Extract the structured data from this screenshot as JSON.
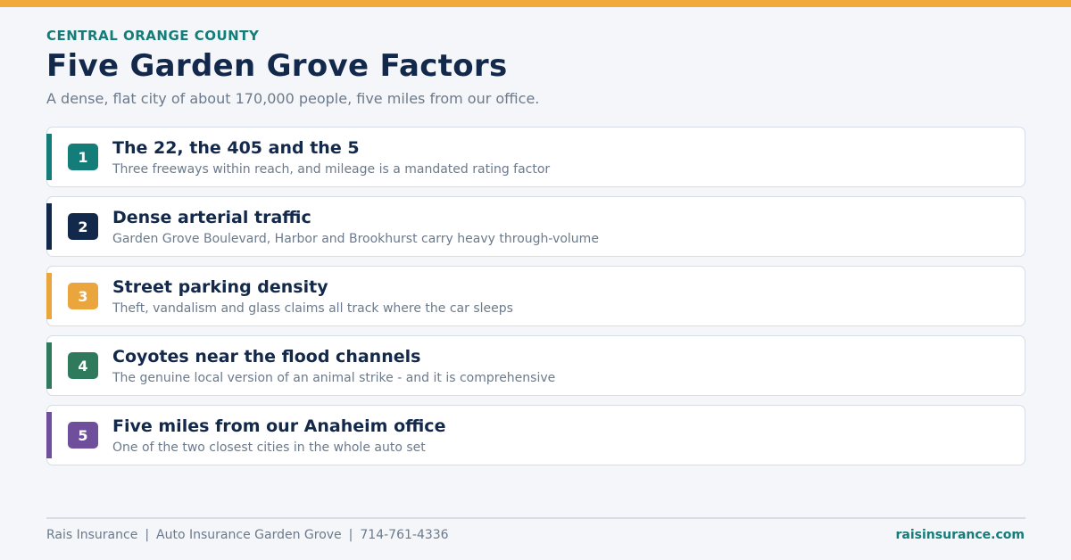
{
  "header": {
    "eyebrow": "CENTRAL ORANGE COUNTY",
    "title": "Five Garden Grove Factors",
    "subtitle": "A dense, flat city of about 170,000 people, five miles from our office."
  },
  "factors": [
    {
      "number": "1",
      "title": "The 22, the 405 and the 5",
      "description": "Three freeways within reach, and mileage is a mandated rating factor",
      "color": "#147d7a"
    },
    {
      "number": "2",
      "title": "Dense arterial traffic",
      "description": "Garden Grove Boulevard, Harbor and Brookhurst carry heavy through-volume",
      "color": "#13294b"
    },
    {
      "number": "3",
      "title": "Street parking density",
      "description": "Theft, vandalism and glass claims all track where the car sleeps",
      "color": "#eba53d"
    },
    {
      "number": "4",
      "title": "Coyotes near the flood channels",
      "description": "The genuine local version of an animal strike - and it is comprehensive",
      "color": "#2f7a5c"
    },
    {
      "number": "5",
      "title": "Five miles from our Anaheim office",
      "description": "One of the two closest cities in the whole auto set",
      "color": "#6f4f9c"
    }
  ],
  "footer": {
    "company": "Rais Insurance",
    "page": "Auto Insurance Garden Grove",
    "phone": "714-761-4336",
    "website": "raisinsurance.com",
    "separator": "|"
  },
  "colors": {
    "top_bar": "#f0a93a",
    "eyebrow": "#147d7a",
    "title": "#13294b"
  }
}
